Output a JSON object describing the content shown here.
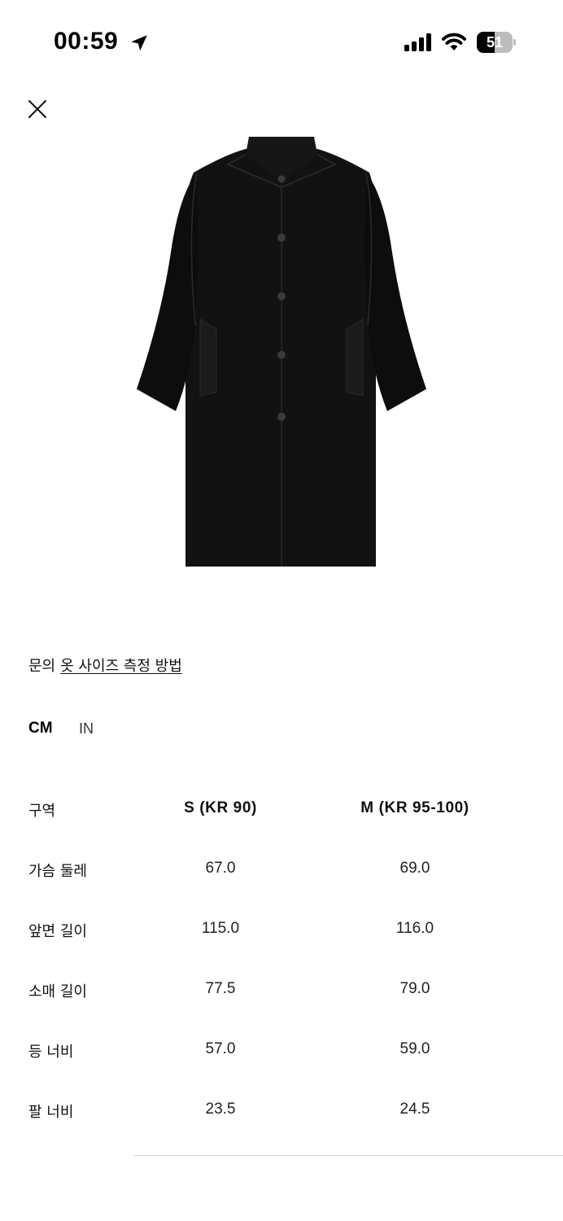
{
  "status_bar": {
    "time": "00:59",
    "battery_level": "51",
    "battery_fraction": 0.51
  },
  "links": {
    "contact": "문의",
    "measure_guide": "옷 사이즈 측정 방법"
  },
  "units": {
    "cm": "CM",
    "in": "IN",
    "selected": "CM"
  },
  "size_table": {
    "headers": [
      "구역",
      "S (KR 90)",
      "M (KR 95-100)"
    ],
    "rows": [
      [
        "가슴 둘레",
        "67.0",
        "69.0"
      ],
      [
        "앞면 길이",
        "115.0",
        "116.0"
      ],
      [
        "소매 길이",
        "77.5",
        "79.0"
      ],
      [
        "등 너비",
        "57.0",
        "59.0"
      ],
      [
        "팔 너비",
        "23.5",
        "24.5"
      ]
    ]
  }
}
